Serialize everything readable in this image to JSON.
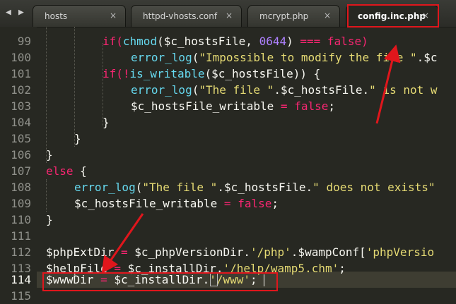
{
  "tab_bar": {
    "prev_icon": "triangle-left-icon",
    "next_icon": "triangle-right-icon",
    "close_icon": "close-icon",
    "tabs": [
      {
        "label": "hosts",
        "close": "×"
      },
      {
        "label": "httpd-vhosts.conf",
        "close": "×"
      },
      {
        "label": "mcrypt.php",
        "close": "×"
      },
      {
        "label": "config.inc.php",
        "close": "×"
      }
    ],
    "active_tab": "config.inc.php"
  },
  "editor": {
    "theme": "dark",
    "current_line": "114",
    "line_numbers": [
      "99",
      "100",
      "101",
      "102",
      "103",
      "104",
      "105",
      "106",
      "107",
      "108",
      "109",
      "110",
      "111",
      "112",
      "113",
      "114",
      "115"
    ],
    "lines": {
      "l99": {
        "a": "if(",
        "b": "chmod",
        "c": "($c_hostsFile, ",
        "d": "0644",
        "e": ") ",
        "f": "===",
        "g": " false)"
      },
      "l100": {
        "a": "error_log",
        "b": "(",
        "c": "\"Impossible to modify the file \"",
        "d": ".$c"
      },
      "l101": {
        "a": "if(!",
        "b": "is_writable",
        "c": "($c_hostsFile)) {"
      },
      "l102": {
        "a": "error_log",
        "b": "(",
        "c": "\"The file \"",
        "d": ".$c_hostsFile.",
        "e": "\" is not w"
      },
      "l103": {
        "a": "$c_hostsFile_writable ",
        "b": "=",
        "c": " ",
        "d": "false",
        "e": ";"
      },
      "l104": {
        "a": "}"
      },
      "l105": {
        "a": "}"
      },
      "l106": {
        "a": "}"
      },
      "l107": {
        "a": "else",
        "b": " {"
      },
      "l108": {
        "a": "error_log",
        "b": "(",
        "c": "\"The file \"",
        "d": ".$c_hostsFile.",
        "e": "\" does not exists\""
      },
      "l109": {
        "a": "$c_hostsFile_writable ",
        "b": "=",
        "c": " ",
        "d": "false",
        "e": ";"
      },
      "l110": {
        "a": "}"
      },
      "l112": {
        "a": "$phpExtDir ",
        "b": "=",
        "c": " $c_phpVersionDir.",
        "d": "'/php'",
        "e": ".$wampConf[",
        "f": "'phpVersio"
      },
      "l113": {
        "a": "$helpFile ",
        "b": "=",
        "c": " $c_installDir.",
        "d": "'/help/wamp5.chm'",
        "e": ";"
      },
      "l114": {
        "a": "$wwwDir ",
        "b": "=",
        "c": " $c_installDir.",
        "d": "'/www'",
        "e": ";"
      }
    }
  }
}
